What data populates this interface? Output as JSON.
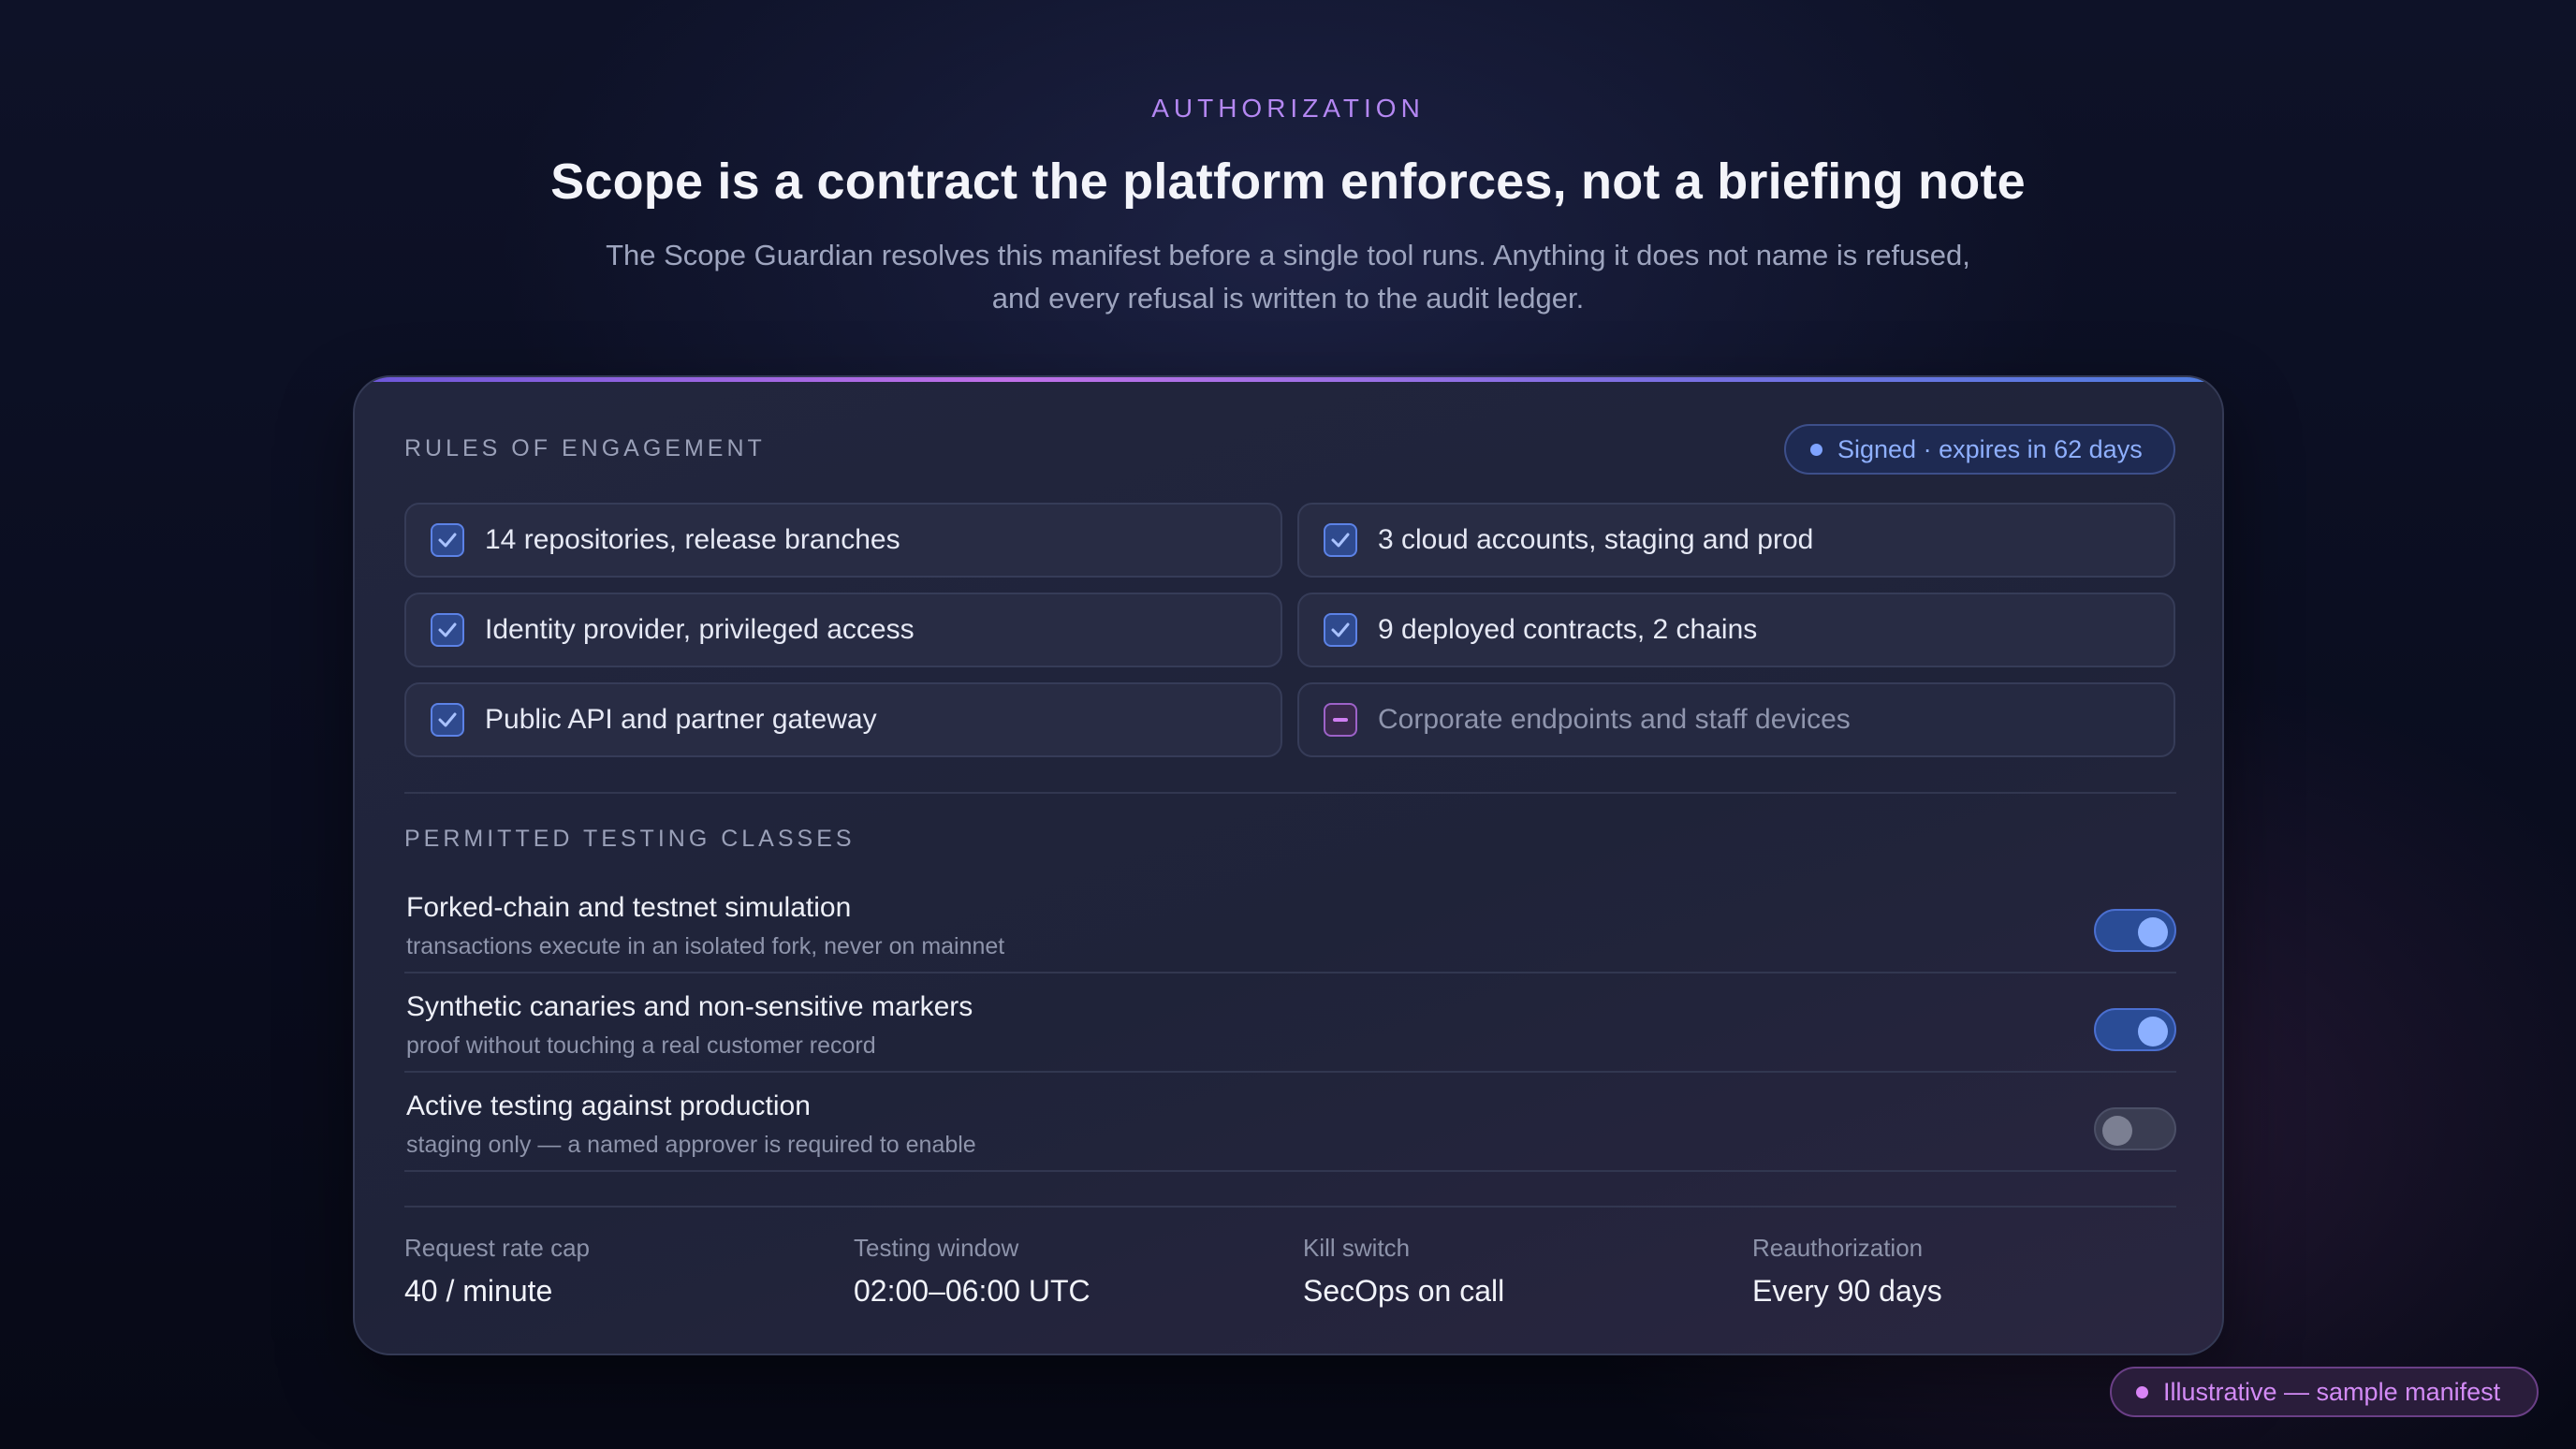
{
  "header": {
    "eyebrow": "AUTHORIZATION",
    "title": "Scope is a contract the platform enforces, not a briefing note",
    "subtitle_line1": "The Scope Guardian resolves this manifest before a single tool runs. Anything it does not name is refused,",
    "subtitle_line2": "and every refusal is written to the audit ledger."
  },
  "rules": {
    "label": "RULES OF ENGAGEMENT",
    "badge": "Signed · expires in 62 days",
    "items": [
      {
        "label": "14 repositories, release branches",
        "status": "included",
        "icon": "check-icon"
      },
      {
        "label": "3 cloud accounts, staging and prod",
        "status": "included",
        "icon": "check-icon"
      },
      {
        "label": "Identity provider, privileged access",
        "status": "included",
        "icon": "check-icon"
      },
      {
        "label": "9 deployed contracts, 2 chains",
        "status": "included",
        "icon": "check-icon"
      },
      {
        "label": "Public API and partner gateway",
        "status": "included",
        "icon": "check-icon"
      },
      {
        "label": "Corporate endpoints and staff devices",
        "status": "excluded",
        "icon": "minus-icon"
      }
    ]
  },
  "testing": {
    "label": "PERMITTED TESTING CLASSES",
    "classes": [
      {
        "title": "Forked-chain and testnet simulation",
        "description": "transactions execute in an isolated fork, never on mainnet",
        "enabled": true
      },
      {
        "title": "Synthetic canaries and non-sensitive markers",
        "description": "proof without touching a real customer record",
        "enabled": true
      },
      {
        "title": "Active testing against production",
        "description": "staging only — a named approver is required to enable",
        "enabled": false
      }
    ]
  },
  "stats": [
    {
      "label": "Request rate cap",
      "value": "40 / minute"
    },
    {
      "label": "Testing window",
      "value": "02:00–06:00 UTC"
    },
    {
      "label": "Kill switch",
      "value": "SecOps on call"
    },
    {
      "label": "Reauthorization",
      "value": "Every 90 days"
    }
  ],
  "footer_badge": "Illustrative — sample manifest",
  "colors": {
    "accent_purple": "#b487f2",
    "accent_blue": "#7fa3ff",
    "toggle_on": "#2a4c96",
    "toggle_off": "#3a3d52",
    "excluded": "#d07ef2"
  }
}
